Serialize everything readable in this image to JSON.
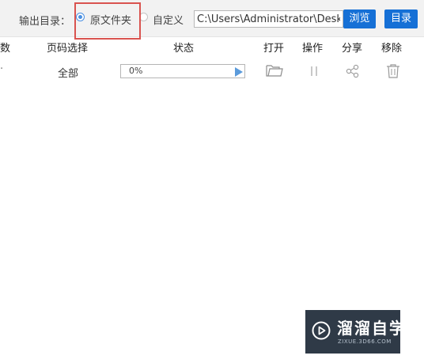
{
  "toolbar": {
    "output_label": "输出目录：",
    "option_original": "原文件夹",
    "option_custom": "自定义",
    "selected_option": "原文件夹",
    "path_value": "C:\\Users\\Administrator\\Deskto",
    "browse_label": "浏览",
    "dir_label": "目录"
  },
  "table": {
    "headers": {
      "count": "数",
      "page_select": "页码选择",
      "status": "状态",
      "open": "打开",
      "operate": "操作",
      "share": "分享",
      "remove": "移除"
    },
    "rows": [
      {
        "count": "·",
        "page_select": "全部",
        "progress_percent": 0,
        "progress_text": "0%"
      }
    ]
  },
  "icons": {
    "open": "folder-icon",
    "operate": "pause-icon",
    "share": "share-icon",
    "remove": "trash-icon",
    "play": "play-icon"
  },
  "watermark": {
    "title": "溜溜自学",
    "subtitle": "ZIXUE.3D66.COM"
  },
  "colors": {
    "accent": "#1670d6",
    "radio_selected": "#4a90e2",
    "highlight": "#d9534f",
    "play": "#5b9bdb"
  }
}
